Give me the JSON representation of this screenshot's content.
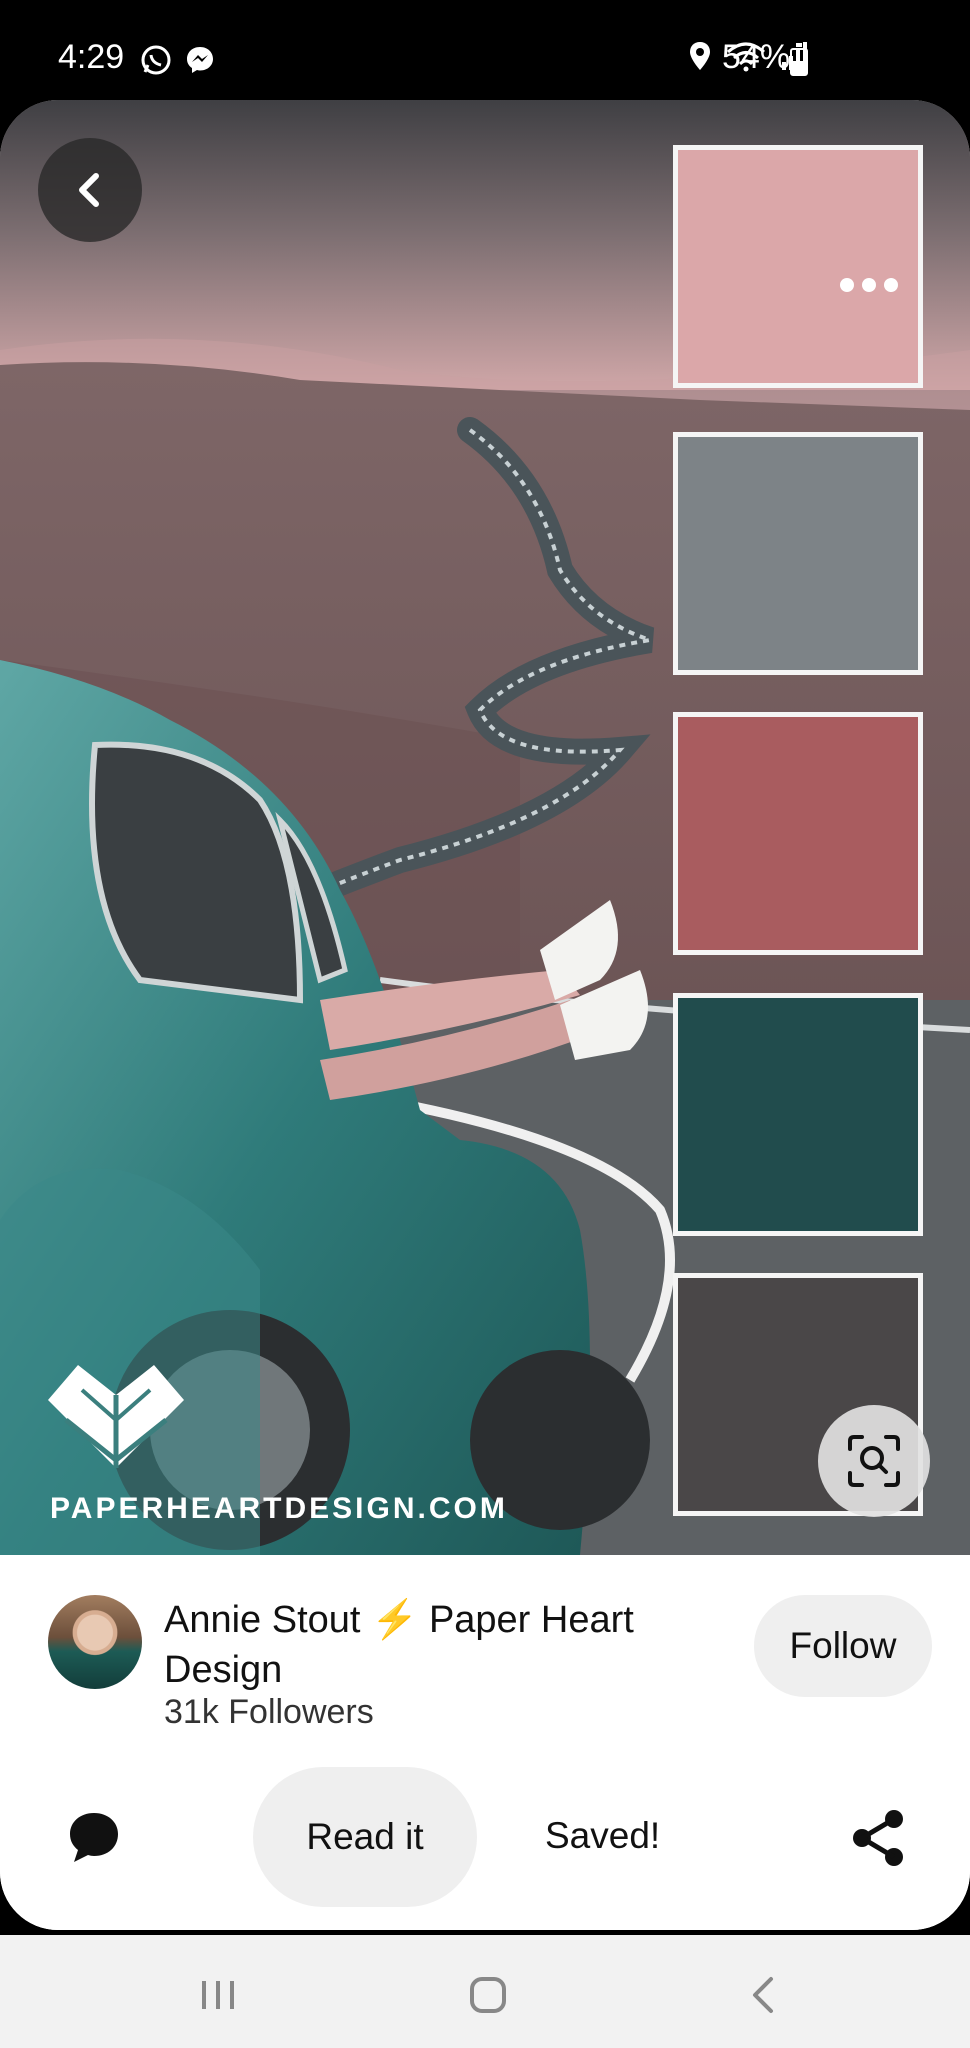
{
  "status_bar": {
    "time": "4:29",
    "battery_percent": "54%",
    "battery_level": 0.54,
    "icons": [
      "whatsapp-icon",
      "messenger-icon",
      "location-icon",
      "wifi-icon",
      "signal-icon",
      "battery-icon"
    ]
  },
  "pin": {
    "watermark": "PAPERHEARTDESIGN.COM",
    "swatches": [
      {
        "name": "blush-pink",
        "color": "#dba7a9"
      },
      {
        "name": "gray",
        "color": "#7d8387"
      },
      {
        "name": "rose-red",
        "color": "#a95c5f"
      },
      {
        "name": "dark-teal",
        "color": "#214c4d"
      },
      {
        "name": "charcoal",
        "color": "#4a4748"
      }
    ],
    "icons": [
      "back-icon",
      "more-icon",
      "visual-search-icon"
    ]
  },
  "creator": {
    "name_part1": "Annie Stout",
    "bolt": "⚡",
    "name_part2": "Paper Heart Design",
    "followers": "31k Followers",
    "follow_label": "Follow"
  },
  "actions": {
    "read_label": "Read it",
    "saved_label": "Saved!",
    "icons": [
      "comment-icon",
      "share-icon"
    ]
  },
  "nav": {
    "icons": [
      "recents-icon",
      "home-icon",
      "back-nav-icon"
    ]
  },
  "colors": {
    "accent_bolt": "#f2b31d",
    "card_bg": "#ffffff",
    "button_bg": "#efefef"
  }
}
